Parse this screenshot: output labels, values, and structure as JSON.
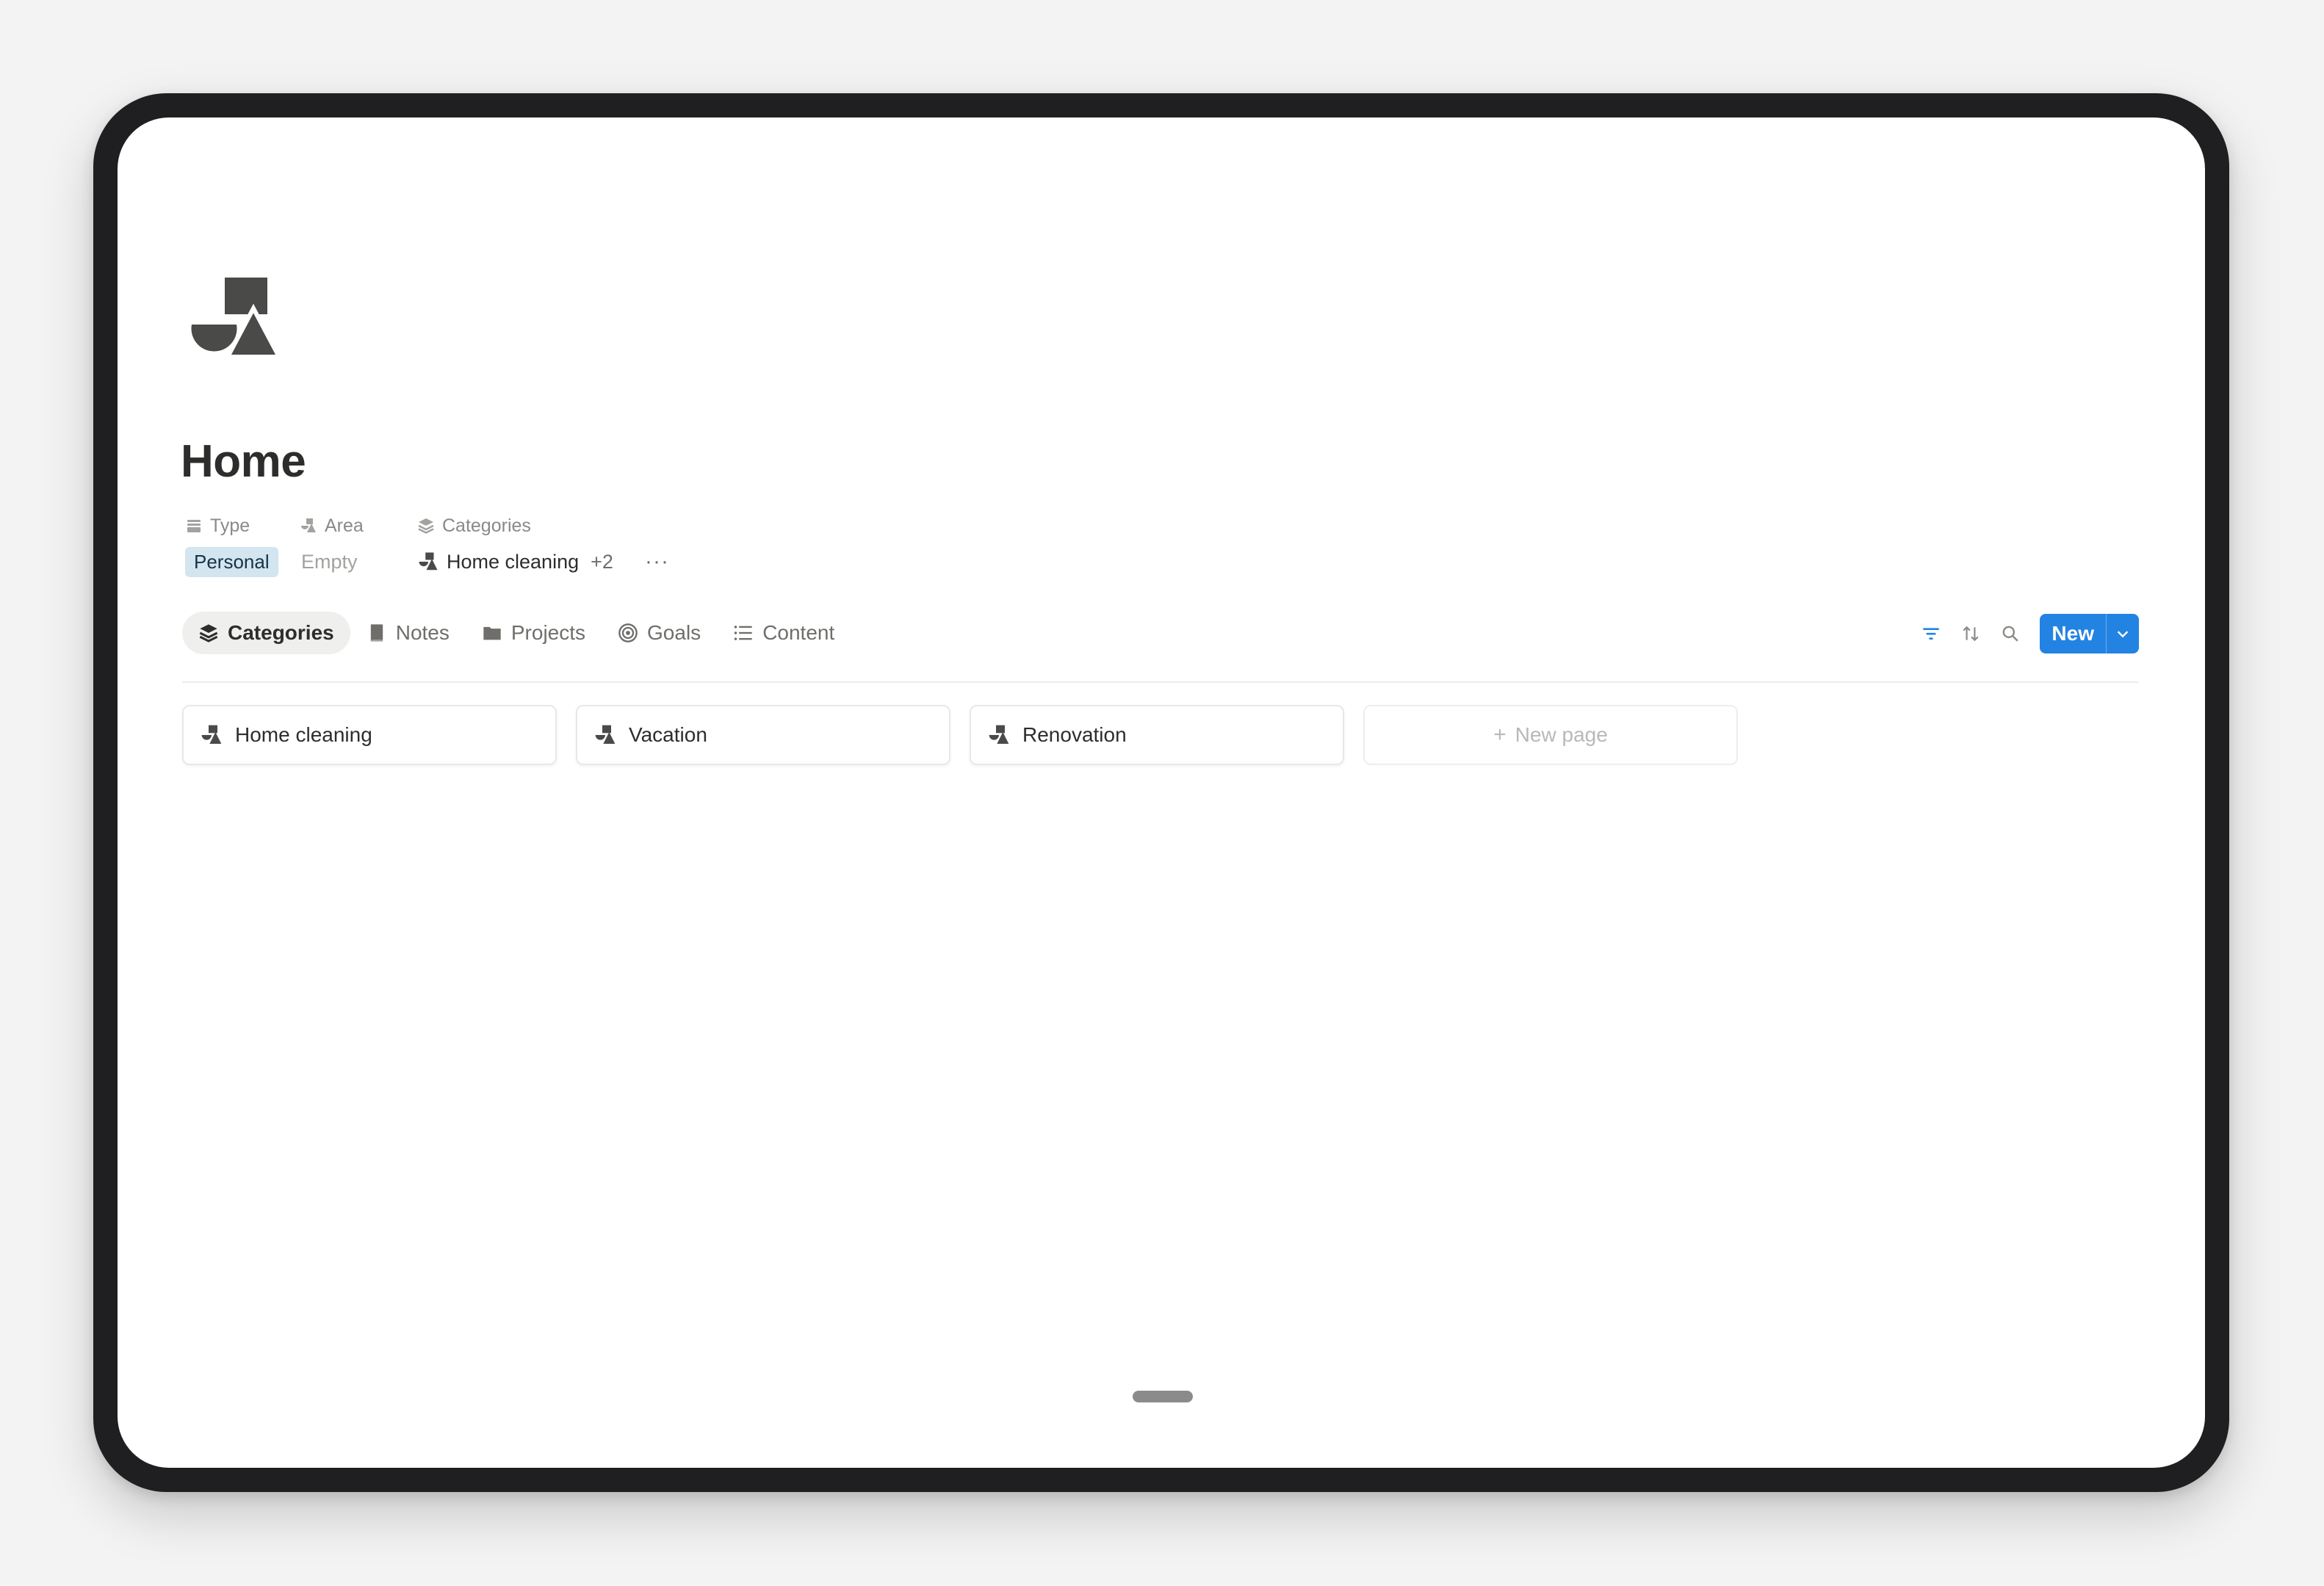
{
  "page": {
    "icon": "shapes-icon",
    "title": "Home"
  },
  "properties": [
    {
      "label": "Type",
      "icon": "type-stack-icon",
      "value": "Personal",
      "value_style": "tag",
      "tag_color": "#d3e5ef"
    },
    {
      "label": "Area",
      "icon": "shapes-icon",
      "value": "Empty",
      "value_style": "empty"
    },
    {
      "label": "Categories",
      "icon": "layers-icon",
      "value": "Home cleaning",
      "more": "+2",
      "value_style": "relation"
    }
  ],
  "more_menu": "···",
  "tabs": [
    {
      "label": "Categories",
      "icon": "layers-icon",
      "active": true
    },
    {
      "label": "Notes",
      "icon": "notebook-icon",
      "active": false
    },
    {
      "label": "Projects",
      "icon": "folder-icon",
      "active": false
    },
    {
      "label": "Goals",
      "icon": "target-icon",
      "active": false
    },
    {
      "label": "Content",
      "icon": "list-icon",
      "active": false
    }
  ],
  "toolbar": {
    "filter_icon": "filter-icon",
    "sort_icon": "sort-icon",
    "search_icon": "search-icon",
    "new_label": "New",
    "accent": "#2383e2"
  },
  "cards": [
    {
      "label": "Home cleaning",
      "icon": "shapes-icon"
    },
    {
      "label": "Vacation",
      "icon": "shapes-icon"
    },
    {
      "label": "Renovation",
      "icon": "shapes-icon"
    }
  ],
  "new_page_label": "New page"
}
